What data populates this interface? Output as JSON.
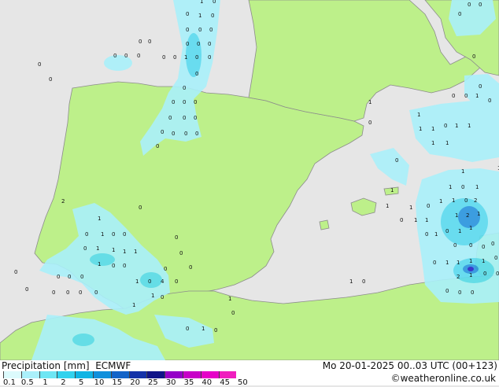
{
  "title": "Precipitation [mm]",
  "model": "ECMWF",
  "timestamp": "Mo 20-01-2025 00..03 UTC (00+123)",
  "credit": "©weatheronline.co.uk",
  "colors": {
    "sea": "#e6e6e6",
    "land": "#bdf08a",
    "precip_light": "#aaf0fa",
    "precip_mid": "#5cdcf0",
    "precip_heavy": "#2a96e0",
    "precip_core": "#2828c8"
  },
  "legend": {
    "ticks": [
      "0.1",
      "0.5",
      "1",
      "2",
      "5",
      "10",
      "15",
      "20",
      "25",
      "30",
      "35",
      "40",
      "45",
      "50"
    ],
    "colors": [
      "#dcfafc",
      "#aaf0fa",
      "#6ee6f4",
      "#32d2ee",
      "#10b4e4",
      "#1090dc",
      "#1464c8",
      "#1432a8",
      "#101488",
      "#9600c8",
      "#c800c8",
      "#e600c8",
      "#f01ebe"
    ]
  },
  "value_labels": [
    "1",
    "0",
    "0",
    "1",
    "0",
    "0",
    "0",
    "0",
    "0",
    "0",
    "0",
    "0",
    "0",
    "1",
    "0",
    "0",
    "0",
    "0",
    "0",
    "0",
    "0",
    "0",
    "0",
    "0",
    "0",
    "0",
    "0",
    "0",
    "0",
    "0",
    "0",
    "0",
    "0",
    "0",
    "0",
    "0",
    "0",
    "0",
    "0",
    "0",
    "0",
    "0",
    "1",
    "0",
    "0",
    "1",
    "1",
    "0",
    "1",
    "1",
    "0",
    "1",
    "1",
    "1",
    "1",
    "0",
    "1",
    "1",
    "1",
    "0",
    "1",
    "2",
    "0",
    "1",
    "1",
    "0",
    "1",
    "1",
    "2",
    "1",
    "1",
    "1",
    "0",
    "1",
    "0",
    "1",
    "1",
    "0",
    "1",
    "1",
    "0",
    "0",
    "0",
    "0",
    "0",
    "1",
    "1",
    "1",
    "1",
    "0",
    "2",
    "1",
    "0",
    "0",
    "0",
    "0",
    "0",
    "1",
    "0",
    "2",
    "0",
    "1",
    "0",
    "1",
    "0",
    "0",
    "1",
    "1",
    "1",
    "1",
    "0",
    "0",
    "0",
    "0",
    "1",
    "0",
    "0",
    "0",
    "0",
    "0",
    "1",
    "0",
    "4",
    "0",
    "0",
    "0",
    "0",
    "0",
    "0",
    "0",
    "0",
    "1",
    "0",
    "1"
  ]
}
